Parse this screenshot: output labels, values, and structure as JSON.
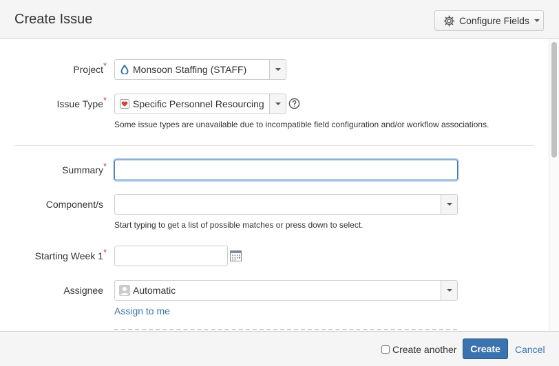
{
  "dialog": {
    "title": "Create Issue",
    "configure_fields_label": "Configure Fields"
  },
  "form": {
    "project": {
      "label": "Project",
      "required": "*",
      "value": "Monsoon Staffing (STAFF)",
      "icon": "monsoon-project-icon"
    },
    "issue_type": {
      "label": "Issue Type",
      "required": "*",
      "value": "Specific Personnel Resourcing",
      "icon": "heart-issue-type-icon",
      "note": "Some issue types are unavailable due to incompatible field configuration and/or workflow associations."
    },
    "summary": {
      "label": "Summary",
      "required": "*",
      "value": ""
    },
    "components": {
      "label": "Component/s",
      "value": "",
      "hint": "Start typing to get a list of possible matches or press down to select."
    },
    "starting_week": {
      "label": "Starting Week 1",
      "required": "*",
      "value": ""
    },
    "assignee": {
      "label": "Assignee",
      "value": "Automatic",
      "assign_to_me": "Assign to me"
    }
  },
  "footer": {
    "create_another_label": "Create another",
    "create_another_checked": false,
    "create_label": "Create",
    "cancel_label": "Cancel"
  },
  "colors": {
    "accent": "#3b73af",
    "required": "#d04437",
    "header_bg": "#f5f5f5"
  }
}
